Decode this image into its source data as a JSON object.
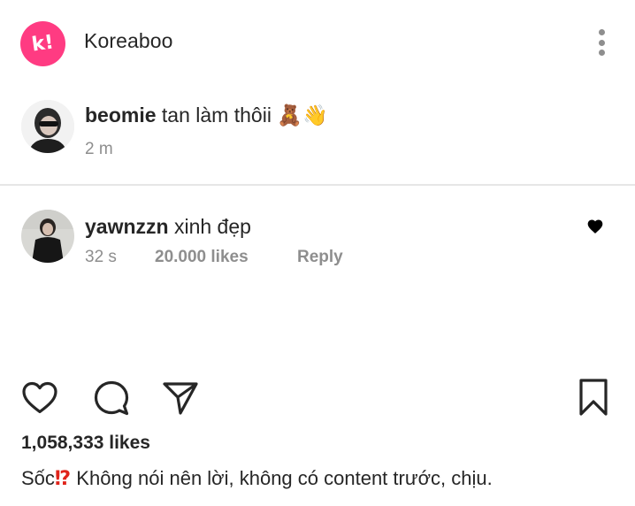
{
  "header": {
    "logo_letter": "k!",
    "account_name": "Koreaboo",
    "brand_color": "#ff3b82",
    "menu_icon": "more-vertical-icon"
  },
  "caption_comment": {
    "username": "beomie",
    "text": "tan làm thôii",
    "emojis": "🧸👋",
    "time": "2 m"
  },
  "reply_comment": {
    "username": "yawnzzn",
    "text": "xinh đẹp",
    "time": "32 s",
    "likes": "20.000 likes",
    "reply_label": "Reply",
    "heart_icon": "heart-filled-icon"
  },
  "actions": {
    "like_icon": "heart-outline-icon",
    "comment_icon": "comment-bubble-icon",
    "share_icon": "paper-plane-icon",
    "save_icon": "bookmark-icon"
  },
  "post": {
    "likes_count": "1,058,333 likes",
    "caption_prefix": "Sốc",
    "caption_emoji": "⁉",
    "caption_text": "Không nói nên lời, không có content trước, chịu."
  }
}
